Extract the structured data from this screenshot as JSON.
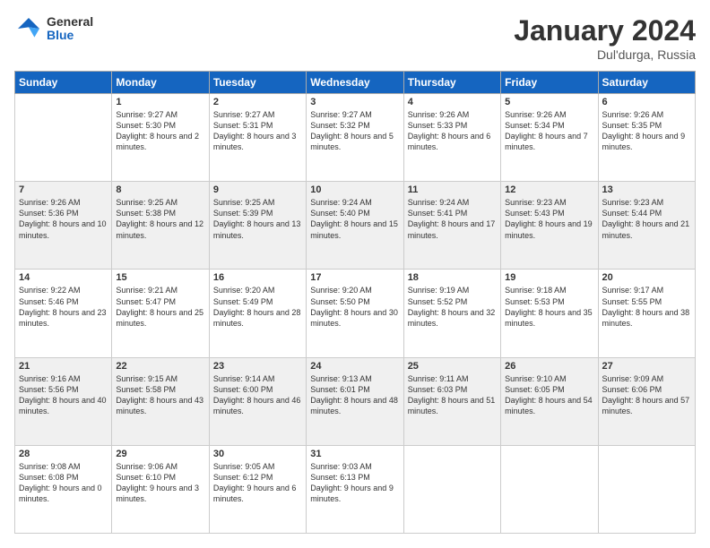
{
  "header": {
    "logo_general": "General",
    "logo_blue": "Blue",
    "month_title": "January 2024",
    "location": "Dul'durga, Russia"
  },
  "days_of_week": [
    "Sunday",
    "Monday",
    "Tuesday",
    "Wednesday",
    "Thursday",
    "Friday",
    "Saturday"
  ],
  "weeks": [
    [
      {
        "num": "",
        "sunrise": "",
        "sunset": "",
        "daylight": "",
        "empty": true
      },
      {
        "num": "1",
        "sunrise": "Sunrise: 9:27 AM",
        "sunset": "Sunset: 5:30 PM",
        "daylight": "Daylight: 8 hours and 2 minutes."
      },
      {
        "num": "2",
        "sunrise": "Sunrise: 9:27 AM",
        "sunset": "Sunset: 5:31 PM",
        "daylight": "Daylight: 8 hours and 3 minutes."
      },
      {
        "num": "3",
        "sunrise": "Sunrise: 9:27 AM",
        "sunset": "Sunset: 5:32 PM",
        "daylight": "Daylight: 8 hours and 5 minutes."
      },
      {
        "num": "4",
        "sunrise": "Sunrise: 9:26 AM",
        "sunset": "Sunset: 5:33 PM",
        "daylight": "Daylight: 8 hours and 6 minutes."
      },
      {
        "num": "5",
        "sunrise": "Sunrise: 9:26 AM",
        "sunset": "Sunset: 5:34 PM",
        "daylight": "Daylight: 8 hours and 7 minutes."
      },
      {
        "num": "6",
        "sunrise": "Sunrise: 9:26 AM",
        "sunset": "Sunset: 5:35 PM",
        "daylight": "Daylight: 8 hours and 9 minutes."
      }
    ],
    [
      {
        "num": "7",
        "sunrise": "Sunrise: 9:26 AM",
        "sunset": "Sunset: 5:36 PM",
        "daylight": "Daylight: 8 hours and 10 minutes."
      },
      {
        "num": "8",
        "sunrise": "Sunrise: 9:25 AM",
        "sunset": "Sunset: 5:38 PM",
        "daylight": "Daylight: 8 hours and 12 minutes."
      },
      {
        "num": "9",
        "sunrise": "Sunrise: 9:25 AM",
        "sunset": "Sunset: 5:39 PM",
        "daylight": "Daylight: 8 hours and 13 minutes."
      },
      {
        "num": "10",
        "sunrise": "Sunrise: 9:24 AM",
        "sunset": "Sunset: 5:40 PM",
        "daylight": "Daylight: 8 hours and 15 minutes."
      },
      {
        "num": "11",
        "sunrise": "Sunrise: 9:24 AM",
        "sunset": "Sunset: 5:41 PM",
        "daylight": "Daylight: 8 hours and 17 minutes."
      },
      {
        "num": "12",
        "sunrise": "Sunrise: 9:23 AM",
        "sunset": "Sunset: 5:43 PM",
        "daylight": "Daylight: 8 hours and 19 minutes."
      },
      {
        "num": "13",
        "sunrise": "Sunrise: 9:23 AM",
        "sunset": "Sunset: 5:44 PM",
        "daylight": "Daylight: 8 hours and 21 minutes."
      }
    ],
    [
      {
        "num": "14",
        "sunrise": "Sunrise: 9:22 AM",
        "sunset": "Sunset: 5:46 PM",
        "daylight": "Daylight: 8 hours and 23 minutes."
      },
      {
        "num": "15",
        "sunrise": "Sunrise: 9:21 AM",
        "sunset": "Sunset: 5:47 PM",
        "daylight": "Daylight: 8 hours and 25 minutes."
      },
      {
        "num": "16",
        "sunrise": "Sunrise: 9:20 AM",
        "sunset": "Sunset: 5:49 PM",
        "daylight": "Daylight: 8 hours and 28 minutes."
      },
      {
        "num": "17",
        "sunrise": "Sunrise: 9:20 AM",
        "sunset": "Sunset: 5:50 PM",
        "daylight": "Daylight: 8 hours and 30 minutes."
      },
      {
        "num": "18",
        "sunrise": "Sunrise: 9:19 AM",
        "sunset": "Sunset: 5:52 PM",
        "daylight": "Daylight: 8 hours and 32 minutes."
      },
      {
        "num": "19",
        "sunrise": "Sunrise: 9:18 AM",
        "sunset": "Sunset: 5:53 PM",
        "daylight": "Daylight: 8 hours and 35 minutes."
      },
      {
        "num": "20",
        "sunrise": "Sunrise: 9:17 AM",
        "sunset": "Sunset: 5:55 PM",
        "daylight": "Daylight: 8 hours and 38 minutes."
      }
    ],
    [
      {
        "num": "21",
        "sunrise": "Sunrise: 9:16 AM",
        "sunset": "Sunset: 5:56 PM",
        "daylight": "Daylight: 8 hours and 40 minutes."
      },
      {
        "num": "22",
        "sunrise": "Sunrise: 9:15 AM",
        "sunset": "Sunset: 5:58 PM",
        "daylight": "Daylight: 8 hours and 43 minutes."
      },
      {
        "num": "23",
        "sunrise": "Sunrise: 9:14 AM",
        "sunset": "Sunset: 6:00 PM",
        "daylight": "Daylight: 8 hours and 46 minutes."
      },
      {
        "num": "24",
        "sunrise": "Sunrise: 9:13 AM",
        "sunset": "Sunset: 6:01 PM",
        "daylight": "Daylight: 8 hours and 48 minutes."
      },
      {
        "num": "25",
        "sunrise": "Sunrise: 9:11 AM",
        "sunset": "Sunset: 6:03 PM",
        "daylight": "Daylight: 8 hours and 51 minutes."
      },
      {
        "num": "26",
        "sunrise": "Sunrise: 9:10 AM",
        "sunset": "Sunset: 6:05 PM",
        "daylight": "Daylight: 8 hours and 54 minutes."
      },
      {
        "num": "27",
        "sunrise": "Sunrise: 9:09 AM",
        "sunset": "Sunset: 6:06 PM",
        "daylight": "Daylight: 8 hours and 57 minutes."
      }
    ],
    [
      {
        "num": "28",
        "sunrise": "Sunrise: 9:08 AM",
        "sunset": "Sunset: 6:08 PM",
        "daylight": "Daylight: 9 hours and 0 minutes."
      },
      {
        "num": "29",
        "sunrise": "Sunrise: 9:06 AM",
        "sunset": "Sunset: 6:10 PM",
        "daylight": "Daylight: 9 hours and 3 minutes."
      },
      {
        "num": "30",
        "sunrise": "Sunrise: 9:05 AM",
        "sunset": "Sunset: 6:12 PM",
        "daylight": "Daylight: 9 hours and 6 minutes."
      },
      {
        "num": "31",
        "sunrise": "Sunrise: 9:03 AM",
        "sunset": "Sunset: 6:13 PM",
        "daylight": "Daylight: 9 hours and 9 minutes."
      },
      {
        "num": "",
        "sunrise": "",
        "sunset": "",
        "daylight": "",
        "empty": true
      },
      {
        "num": "",
        "sunrise": "",
        "sunset": "",
        "daylight": "",
        "empty": true
      },
      {
        "num": "",
        "sunrise": "",
        "sunset": "",
        "daylight": "",
        "empty": true
      }
    ]
  ]
}
